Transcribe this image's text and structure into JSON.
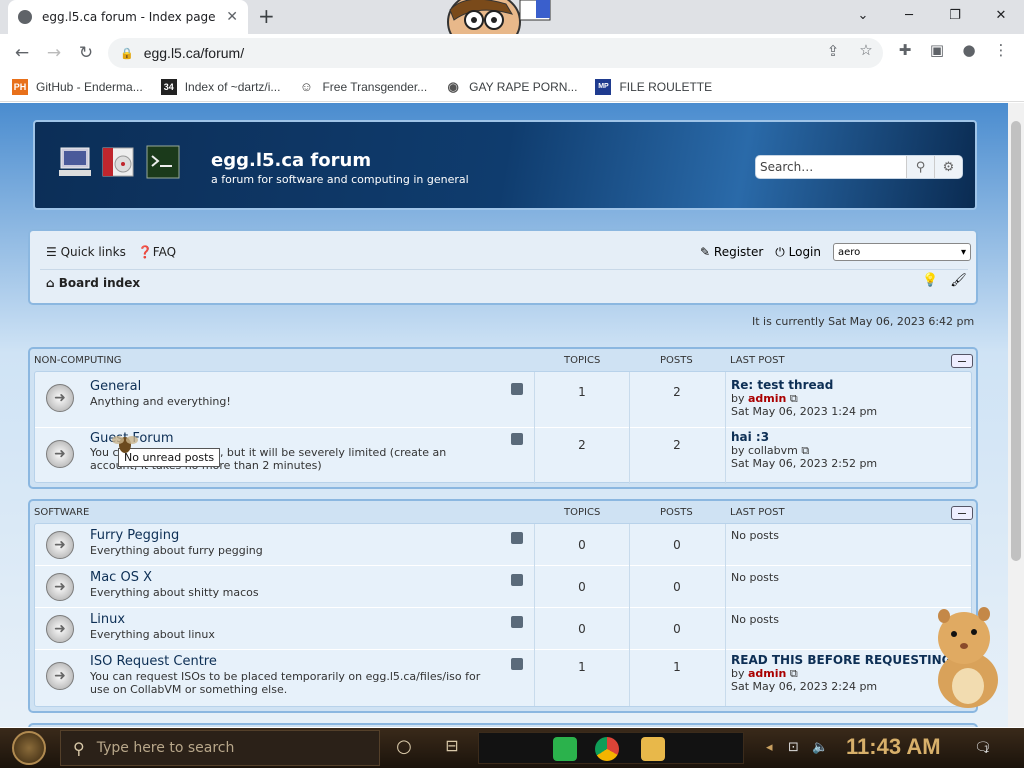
{
  "browser": {
    "tab_title": "egg.l5.ca forum - Index page",
    "url": "egg.l5.ca/forum/",
    "bookmarks": [
      {
        "label": "GitHub - Enderma...",
        "icon": "producthunt-icon",
        "color": "#e8701a",
        "glyph": "PH"
      },
      {
        "label": "Index of ~dartz/i...",
        "icon": "dartz-icon",
        "color": "#222222",
        "glyph": "34"
      },
      {
        "label": "Free Transgender...",
        "icon": "mask-icon",
        "color": "#666666",
        "glyph": "☺"
      },
      {
        "label": "GAY RAPE PORN...",
        "icon": "globe-icon",
        "color": "#666666",
        "glyph": "◉"
      },
      {
        "label": "FILE ROULETTE",
        "icon": "roulette-icon",
        "color": "#1f3b8f",
        "glyph": "MP"
      }
    ]
  },
  "forum": {
    "site_name": "egg.l5.ca forum",
    "site_desc": "a forum for software and computing in general",
    "search_placeholder": "Search…",
    "nav": {
      "quick_links": "Quick links",
      "faq": "FAQ",
      "register": "Register",
      "login": "Login",
      "style": "aero",
      "board_index": "Board index"
    },
    "datetime": "It is currently Sat May 06, 2023 6:42 pm",
    "col_topics": "TOPICS",
    "col_posts": "POSTS",
    "col_lastpost": "LAST POST",
    "categories": [
      {
        "name": "NON-COMPUTING",
        "forums": [
          {
            "title": "General",
            "desc": "Anything and everything!",
            "topics": "1",
            "posts": "2",
            "lp_title": "Re: test thread",
            "lp_by": "by",
            "lp_user": "admin",
            "lp_date": "Sat May 06, 2023 1:24 pm"
          },
          {
            "title": "Guest Forum",
            "desc": "You can post as a guest, but it will be severely limited (create an account, it takes no more than 2 minutes)",
            "topics": "2",
            "posts": "2",
            "lp_title": "hai :3",
            "lp_by": "by",
            "lp_user": "collabvm",
            "lp_date": "Sat May 06, 2023 2:52 pm"
          }
        ]
      },
      {
        "name": "SOFTWARE",
        "forums": [
          {
            "title": "Furry Pegging",
            "desc": "Everything about furry pegging",
            "topics": "0",
            "posts": "0",
            "lp_none": "No posts"
          },
          {
            "title": "Mac OS X",
            "desc": "Everything about shitty macos",
            "topics": "0",
            "posts": "0",
            "lp_none": "No posts"
          },
          {
            "title": "Linux",
            "desc": "Everything about linux",
            "topics": "0",
            "posts": "0",
            "lp_none": "No posts"
          },
          {
            "title": "ISO Request Centre",
            "desc": "You can request ISOs to be placed temporarily on egg.l5.ca/files/iso for use on CollabVM or something else.",
            "topics": "1",
            "posts": "1",
            "lp_title": "READ THIS BEFORE REQUESTING!",
            "lp_by": "by",
            "lp_user": "admin",
            "lp_date": "Sat May 06, 2023 2:24 pm"
          }
        ]
      }
    ],
    "tooltip": "No unread posts"
  },
  "taskbar": {
    "search_placeholder": "Type here to search",
    "clock": "11:43 AM",
    "notification_count": "1"
  },
  "colors": {
    "accent": "#0d2f55",
    "username": "#aa0000",
    "header_bg": "#0f3c6e"
  }
}
